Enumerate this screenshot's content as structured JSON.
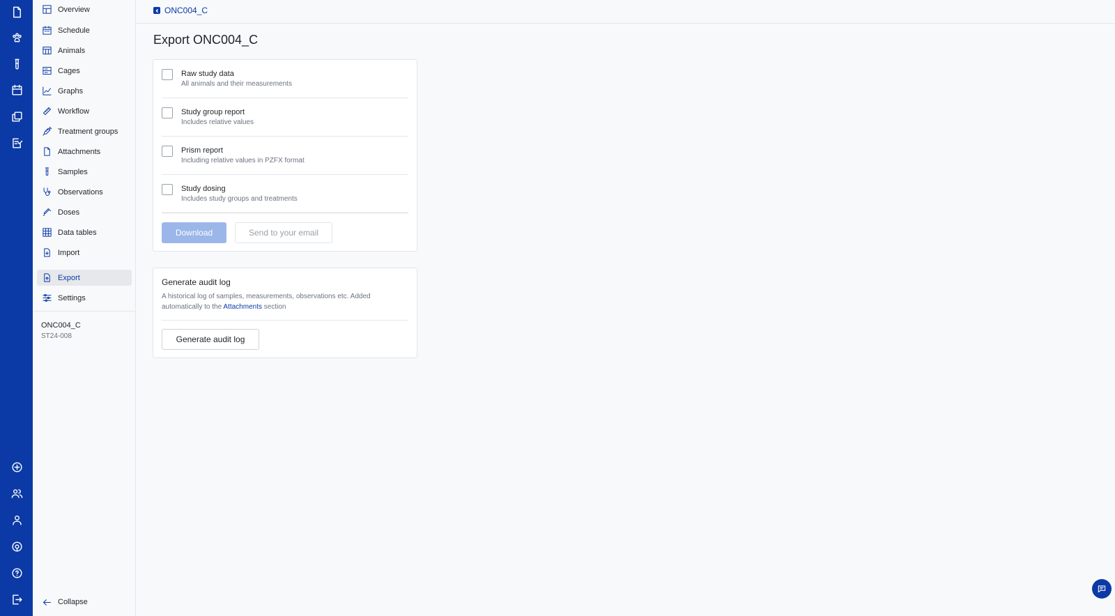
{
  "breadcrumb": {
    "label": "ONC004_C"
  },
  "page": {
    "title": "Export ONC004_C"
  },
  "rail": {
    "top": [
      {
        "icon": "file-icon"
      },
      {
        "icon": "paw-icon"
      },
      {
        "icon": "test-tube-icon"
      },
      {
        "icon": "calendar-icon"
      },
      {
        "icon": "copy-icon"
      },
      {
        "icon": "checklist-icon"
      }
    ],
    "bottom": [
      {
        "icon": "plus-circle-icon"
      },
      {
        "icon": "users-icon"
      },
      {
        "icon": "user-icon"
      },
      {
        "icon": "support-icon"
      },
      {
        "icon": "help-icon"
      },
      {
        "icon": "logout-icon"
      }
    ]
  },
  "nav": {
    "items": [
      {
        "label": "Overview",
        "icon": "layout-icon"
      },
      {
        "label": "Schedule",
        "icon": "calendar-icon"
      },
      {
        "label": "Animals",
        "icon": "table-icon"
      },
      {
        "label": "Cages",
        "icon": "cage-icon"
      },
      {
        "label": "Graphs",
        "icon": "line-chart-icon"
      },
      {
        "label": "Workflow",
        "icon": "ruler-icon"
      },
      {
        "label": "Treatment groups",
        "icon": "syringe-icon"
      },
      {
        "label": "Attachments",
        "icon": "document-icon"
      },
      {
        "label": "Samples",
        "icon": "test-tube-icon"
      },
      {
        "label": "Observations",
        "icon": "stethoscope-icon"
      },
      {
        "label": "Doses",
        "icon": "dropper-icon"
      },
      {
        "label": "Data tables",
        "icon": "grid-icon"
      },
      {
        "label": "Import",
        "icon": "import-icon"
      },
      {
        "label": "Export",
        "icon": "export-icon",
        "active": true
      },
      {
        "label": "Settings",
        "icon": "sliders-icon"
      }
    ],
    "study_name": "ONC004_C",
    "study_code": "ST24-008",
    "collapse_label": "Collapse"
  },
  "export": {
    "options": [
      {
        "title": "Raw study data",
        "description": "All animals and their measurements",
        "checked": false
      },
      {
        "title": "Study group report",
        "description": "Includes relative values",
        "checked": false
      },
      {
        "title": "Prism report",
        "description": "Including relative values in PZFX format",
        "checked": false
      },
      {
        "title": "Study dosing",
        "description": "Includes study groups and treatments",
        "checked": false
      }
    ],
    "download_label": "Download",
    "email_label": "Send to your email"
  },
  "audit": {
    "title": "Generate audit log",
    "description_prefix": "A historical log of samples, measurements, observations etc. Added automatically to the ",
    "description_link": "Attachments",
    "description_suffix": " section",
    "button_label": "Generate audit log"
  },
  "colors": {
    "primary": "#0b3aa6",
    "disabled_primary": "#9bb6e8",
    "background": "#f8f9fa"
  }
}
